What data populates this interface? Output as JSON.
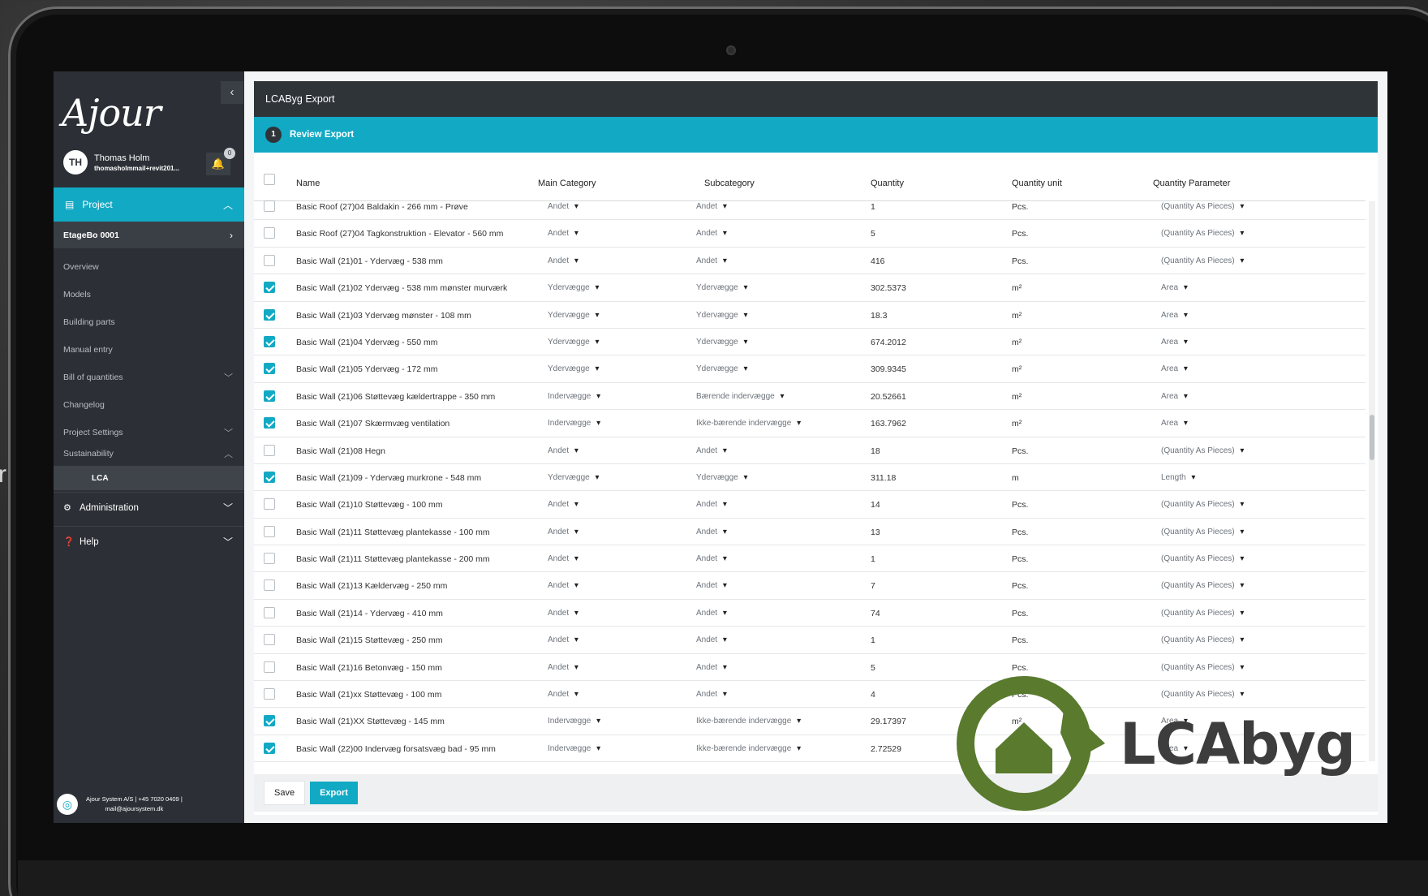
{
  "app": {
    "logo": "Ajour",
    "collapse_icon": "chevron-left-icon",
    "user": {
      "initials": "TH",
      "name": "Thomas Holm",
      "email": "thomasholmmail+revit201...",
      "notifications": "0"
    },
    "nav": {
      "project": "Project",
      "project_sub": "EtageBo 0001",
      "items": [
        "Overview",
        "Models",
        "Building parts",
        "Manual entry",
        "Bill of quantities",
        "Changelog",
        "Project Settings",
        "Sustainability"
      ],
      "lca": "LCA",
      "administration": "Administration",
      "help": "Help"
    },
    "footer": {
      "line1": "Ajour System A/S  |  +45 7020 0409  |",
      "line2": "mail@ajoursystem.dk"
    }
  },
  "panel": {
    "title": "LCAByg Export",
    "step_number": "1",
    "step_label": "Review Export",
    "columns": [
      "Name",
      "Main Category",
      "Subcategory",
      "Quantity",
      "Quantity unit",
      "Quantity Parameter"
    ],
    "rows": [
      {
        "checked": false,
        "name": "Basic Roof (27)04 Baldakin - 266 mm - Prøve",
        "main": "Andet",
        "sub": "Andet",
        "qty": "1",
        "unit": "Pcs.",
        "param": "(Quantity As Pieces)"
      },
      {
        "checked": false,
        "name": "Basic Roof (27)04 Tagkonstruktion - Elevator - 560 mm",
        "main": "Andet",
        "sub": "Andet",
        "qty": "5",
        "unit": "Pcs.",
        "param": "(Quantity As Pieces)"
      },
      {
        "checked": false,
        "name": "Basic Wall (21)01 - Ydervæg - 538 mm",
        "main": "Andet",
        "sub": "Andet",
        "qty": "416",
        "unit": "Pcs.",
        "param": "(Quantity As Pieces)"
      },
      {
        "checked": true,
        "name": "Basic Wall (21)02 Ydervæg - 538 mm mønster murværk",
        "main": "Ydervægge",
        "sub": "Ydervægge",
        "qty": "302.5373",
        "unit": "m²",
        "param": "Area"
      },
      {
        "checked": true,
        "name": "Basic Wall (21)03 Ydervæg mønster - 108 mm",
        "main": "Ydervægge",
        "sub": "Ydervægge",
        "qty": "18.3",
        "unit": "m²",
        "param": "Area"
      },
      {
        "checked": true,
        "name": "Basic Wall (21)04 Ydervæg - 550 mm",
        "main": "Ydervægge",
        "sub": "Ydervægge",
        "qty": "674.2012",
        "unit": "m²",
        "param": "Area"
      },
      {
        "checked": true,
        "name": "Basic Wall (21)05 Ydervæg - 172 mm",
        "main": "Ydervægge",
        "sub": "Ydervægge",
        "qty": "309.9345",
        "unit": "m²",
        "param": "Area"
      },
      {
        "checked": true,
        "name": "Basic Wall (21)06 Støttevæg kældertrappe - 350 mm",
        "main": "Indervægge",
        "sub": "Bærende indervægge",
        "qty": "20.52661",
        "unit": "m²",
        "param": "Area"
      },
      {
        "checked": true,
        "name": "Basic Wall (21)07 Skærmvæg ventilation",
        "main": "Indervægge",
        "sub": "Ikke-bærende indervægge",
        "qty": "163.7962",
        "unit": "m²",
        "param": "Area"
      },
      {
        "checked": false,
        "name": "Basic Wall (21)08 Hegn",
        "main": "Andet",
        "sub": "Andet",
        "qty": "18",
        "unit": "Pcs.",
        "param": "(Quantity As Pieces)"
      },
      {
        "checked": true,
        "name": "Basic Wall (21)09 - Ydervæg murkrone - 548 mm",
        "main": "Ydervægge",
        "sub": "Ydervægge",
        "qty": "311.18",
        "unit": "m",
        "param": "Length"
      },
      {
        "checked": false,
        "name": "Basic Wall (21)10 Støttevæg - 100 mm",
        "main": "Andet",
        "sub": "Andet",
        "qty": "14",
        "unit": "Pcs.",
        "param": "(Quantity As Pieces)"
      },
      {
        "checked": false,
        "name": "Basic Wall (21)11 Støttevæg plantekasse - 100 mm",
        "main": "Andet",
        "sub": "Andet",
        "qty": "13",
        "unit": "Pcs.",
        "param": "(Quantity As Pieces)"
      },
      {
        "checked": false,
        "name": "Basic Wall (21)11 Støttevæg plantekasse - 200 mm",
        "main": "Andet",
        "sub": "Andet",
        "qty": "1",
        "unit": "Pcs.",
        "param": "(Quantity As Pieces)"
      },
      {
        "checked": false,
        "name": "Basic Wall (21)13 Kældervæg - 250 mm",
        "main": "Andet",
        "sub": "Andet",
        "qty": "7",
        "unit": "Pcs.",
        "param": "(Quantity As Pieces)"
      },
      {
        "checked": false,
        "name": "Basic Wall (21)14 - Ydervæg - 410 mm",
        "main": "Andet",
        "sub": "Andet",
        "qty": "74",
        "unit": "Pcs.",
        "param": "(Quantity As Pieces)"
      },
      {
        "checked": false,
        "name": "Basic Wall (21)15 Støttevæg - 250 mm",
        "main": "Andet",
        "sub": "Andet",
        "qty": "1",
        "unit": "Pcs.",
        "param": "(Quantity As Pieces)"
      },
      {
        "checked": false,
        "name": "Basic Wall (21)16 Betonvæg - 150 mm",
        "main": "Andet",
        "sub": "Andet",
        "qty": "5",
        "unit": "Pcs.",
        "param": "(Quantity As Pieces)"
      },
      {
        "checked": false,
        "name": "Basic Wall (21)xx Støttevæg - 100 mm",
        "main": "Andet",
        "sub": "Andet",
        "qty": "4",
        "unit": "Pcs.",
        "param": "(Quantity As Pieces)"
      },
      {
        "checked": true,
        "name": "Basic Wall (21)XX Støttevæg - 145 mm",
        "main": "Indervægge",
        "sub": "Ikke-bærende indervægge",
        "qty": "29.17397",
        "unit": "m²",
        "param": "Area"
      },
      {
        "checked": true,
        "name": "Basic Wall (22)00 Indervæg forsatsvæg bad - 95 mm",
        "main": "Indervægge",
        "sub": "Ikke-bærende indervægge",
        "qty": "2.72529",
        "unit": "m²",
        "param": "Area"
      }
    ],
    "save_label": "Save",
    "export_label": "Export"
  },
  "overlay": {
    "brand": "LCAbyg",
    "brand_color": "#5a7a2e",
    "text_color": "#3d3d3d"
  },
  "edge_text": "r"
}
